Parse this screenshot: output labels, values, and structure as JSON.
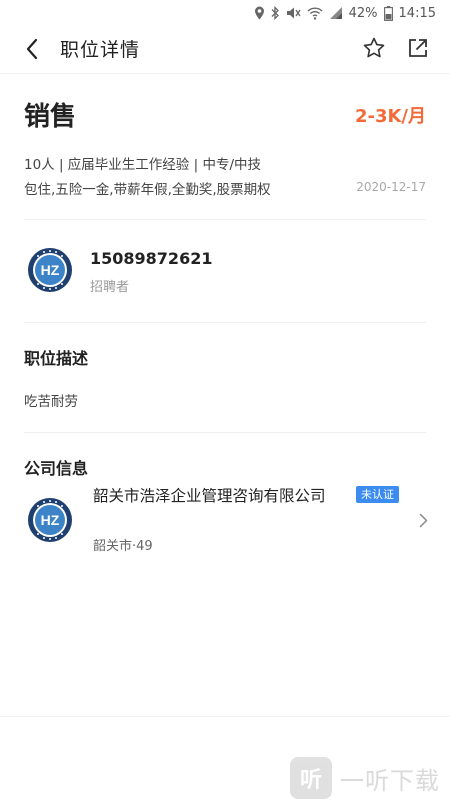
{
  "status_bar": {
    "battery_percent": "42%",
    "time": "14:15",
    "icons": [
      "location-icon",
      "bluetooth-icon",
      "mute-icon",
      "wifi-icon",
      "signal-icon",
      "battery-icon"
    ]
  },
  "nav": {
    "title": "职位详情",
    "back_icon": "chevron-left-icon",
    "favorite_icon": "star-outline-icon",
    "share_icon": "share-external-icon"
  },
  "job": {
    "title": "销售",
    "salary": "2-3K/月",
    "requirements": "10人 | 应届毕业生工作经验 | 中专/中技",
    "welfare": "包住,五险一金,带薪年假,全勤奖,股票期权",
    "date": "2020-12-17"
  },
  "recruiter": {
    "phone": "15089872621",
    "role": "招聘者",
    "avatar_text": "HZ"
  },
  "description": {
    "title": "职位描述",
    "text": "吃苦耐劳"
  },
  "company": {
    "section_title": "公司信息",
    "name": "韶关市浩泽企业管理咨询有限公司",
    "badge": "未认证",
    "meta": "韶关市·49",
    "avatar_text": "HZ"
  },
  "watermark": {
    "logo_glyph": "听",
    "text": "一听下载"
  },
  "colors": {
    "salary": "#f36a39",
    "badge": "#3c8cf0",
    "avatar_ring": "#1f3f6e"
  }
}
